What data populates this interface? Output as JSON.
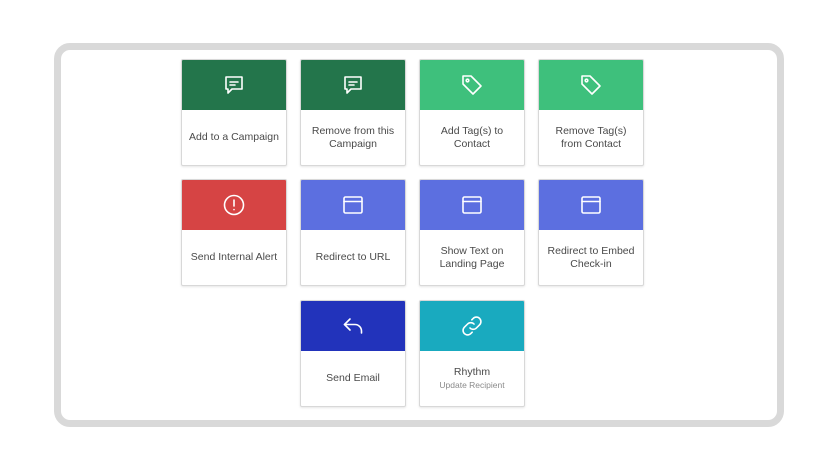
{
  "actions": [
    {
      "label": "Add to a Campaign",
      "icon": "message-icon",
      "color": "#23754b"
    },
    {
      "label": "Remove from this Campaign",
      "icon": "message-icon",
      "color": "#23754b"
    },
    {
      "label": "Add Tag(s) to Contact",
      "icon": "tag-icon",
      "color": "#3ec07c"
    },
    {
      "label": "Remove Tag(s) from Contact",
      "icon": "tag-icon",
      "color": "#3ec07c"
    },
    {
      "label": "Send Internal Alert",
      "icon": "alert-icon",
      "color": "#d64444"
    },
    {
      "label": "Redirect to URL",
      "icon": "browser-window-icon",
      "color": "#5c6fe0"
    },
    {
      "label": "Show Text on Landing Page",
      "icon": "browser-window-icon",
      "color": "#5c6fe0"
    },
    {
      "label": "Redirect to Embed Check-in",
      "icon": "browser-window-icon",
      "color": "#5c6fe0"
    },
    {
      "label": "Send Email",
      "icon": "reply-icon",
      "color": "#2233bb"
    },
    {
      "label": "Rhythm",
      "sublabel": "Update Recipient",
      "icon": "link-icon",
      "color": "#19aabf"
    }
  ]
}
